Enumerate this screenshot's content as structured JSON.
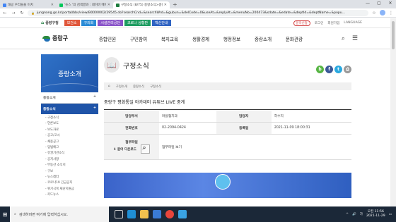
{
  "browser": {
    "tabs": [
      {
        "title": "대공 우리들을 이치",
        "fav": "g",
        "active": false
      },
      {
        "title": "'뉴스 '의 검색결과 : 네이버 메이",
        "fav": "n",
        "active": false
      },
      {
        "title": "구정소식 (8/75) 중랑소식>중랑",
        "fav": "j",
        "active": true
      }
    ],
    "new_tab": "+",
    "window_controls": [
      "—",
      "▢",
      "✕"
    ],
    "url": "jungnang.go.kr/portal/bbs/view/B0000002/29545.do?searchCnd=&searchWrd=&gubun=&delCode=0&useAt=&replyAt=&menuNo=200473&sdate=&edate=&deptId=&deptName=&popu..."
  },
  "site": {
    "home_label": "중랑구청",
    "quick_links": [
      {
        "label": "보건소",
        "color": "#e0573b"
      },
      {
        "label": "구의회",
        "color": "#2a8bd6"
      },
      {
        "label": "시설관리공단",
        "color": "#8a54c9"
      },
      {
        "label": "코로나 상황판",
        "color": "#1e9c61"
      },
      {
        "label": "백신안내",
        "color": "#2f63c2"
      }
    ],
    "util_right": {
      "msg": "문자신청",
      "login": "로그인",
      "join": "회원가입",
      "lang": "LANGUAGE"
    },
    "logo_name": "중랑구",
    "menu": [
      "종합민원",
      "구민참여",
      "복지교육",
      "생활경제",
      "행정정보",
      "중랑소개",
      "문화관광"
    ]
  },
  "sidebar": {
    "title": "중랑소개",
    "sections": [
      {
        "label": "중랑소개",
        "toggle": "+",
        "active": false
      },
      {
        "label": "중랑소식",
        "toggle": "+",
        "active": true
      }
    ],
    "items": [
      "구정소식",
      "언론보도",
      "보도자료",
      "공고/고시",
      "채용공고",
      "입법예고",
      "유권기관소식",
      "공지사항",
      "부동산 소식지",
      "구보",
      "뉴스레터",
      "코로나19 긴급공지",
      "위기극복 재난지원금",
      "카드뉴스"
    ]
  },
  "content": {
    "title": "구정소식",
    "share": [
      {
        "label": "b",
        "color": "#57b544"
      },
      {
        "label": "f",
        "color": "#3b5998"
      },
      {
        "label": "t",
        "color": "#2aa9e0"
      },
      {
        "label": "⎙",
        "color": "#999999"
      }
    ],
    "breadcrumb": [
      "⌂",
      "구정소개",
      "중랑소식",
      "구정소식"
    ],
    "post_title": "중랑구 평화통일 아카데미 유튜브 LIVE 중계",
    "fields": {
      "dept_label": "담당부서",
      "dept_value": "마을협치과",
      "person_label": "담당자",
      "person_value": "하수지",
      "phone_label": "전화번호",
      "phone_value": "02-2094-0424",
      "date_label": "등록일",
      "date_value": "2021-11-09 18:00:31",
      "attach_label": "첨부파일",
      "attach_value": "첨부파일 보기",
      "download_label": "⬇ 원어 다운로드"
    }
  },
  "taskbar": {
    "search_placeholder": "검색하려면 여기에 입력하십시오.",
    "time": "오전 11:56",
    "date": "2021-11-29",
    "lang": "가"
  }
}
